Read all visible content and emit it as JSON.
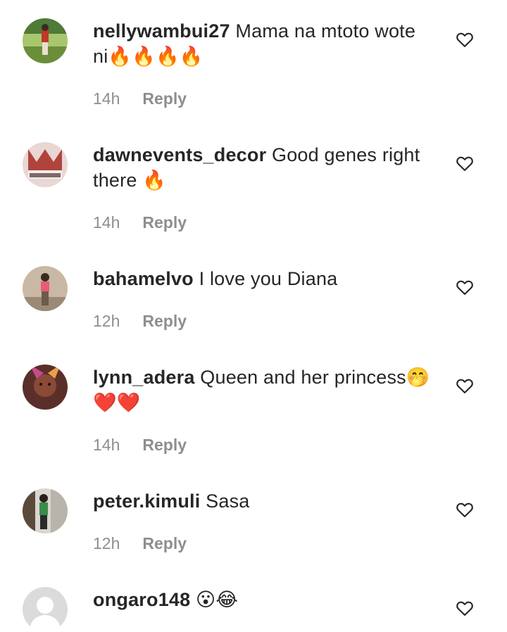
{
  "comments": [
    {
      "username": "nellywambui27",
      "text": "Mama na mtoto wote ni🔥🔥🔥🔥",
      "time": "14h",
      "reply": "Reply",
      "avatar_icon": "user-photo-green",
      "avatar_colors": [
        "#6b8e3a",
        "#c0392b",
        "#a8c66c"
      ]
    },
    {
      "username": "dawnevents_decor",
      "text": "Good genes right there 🔥",
      "time": "14h",
      "reply": "Reply",
      "avatar_icon": "decor-photo",
      "avatar_colors": [
        "#e9d7d4",
        "#b0443d",
        "#7a6b66"
      ]
    },
    {
      "username": "bahamelvo",
      "text": "I love you Diana",
      "time": "12h",
      "reply": "Reply",
      "avatar_icon": "user-photo-pink",
      "avatar_colors": [
        "#c9b8a3",
        "#e85c7a",
        "#6d5a48"
      ]
    },
    {
      "username": "lynn_adera",
      "text": "Queen and her princess🤭❤️❤️",
      "time": "14h",
      "reply": "Reply",
      "avatar_icon": "user-photo-portrait",
      "avatar_colors": [
        "#5a2f2a",
        "#c44b8c",
        "#e8a04a"
      ]
    },
    {
      "username": "peter.kimuli",
      "text": "Sasa",
      "time": "12h",
      "reply": "Reply",
      "avatar_icon": "user-photo-room",
      "avatar_colors": [
        "#d8d6d0",
        "#3b8c4a",
        "#5a4a3a"
      ]
    },
    {
      "username": "ongaro148",
      "text": "😮😂",
      "time": "",
      "reply": "",
      "avatar_icon": "default-avatar",
      "avatar_colors": [
        "#dbdbdb",
        "#ffffff",
        "#ffffff"
      ]
    }
  ],
  "colors": {
    "text": "#262626",
    "secondary": "#8e8e8e",
    "background": "#ffffff"
  }
}
